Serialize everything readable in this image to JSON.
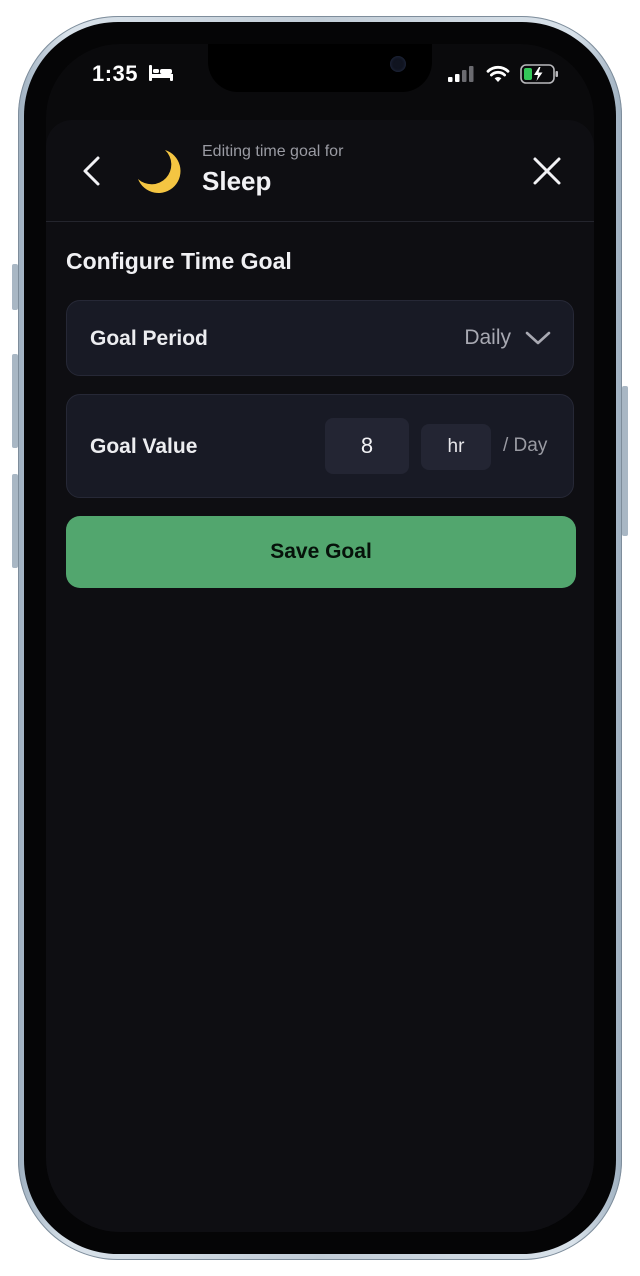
{
  "status_bar": {
    "time": "1:35",
    "sleep_focus_icon": "bed-icon",
    "signal_icon": "cellular-signal-icon",
    "wifi_icon": "wifi-icon",
    "battery_icon": "battery-charging-icon",
    "battery_color": "#34c759"
  },
  "header": {
    "back_icon": "chevron-left-icon",
    "activity_icon": "crescent-moon-icon",
    "subtitle": "Editing time goal for",
    "activity_name": "Sleep",
    "close_icon": "close-icon"
  },
  "section": {
    "title": "Configure Time Goal"
  },
  "goal_period": {
    "label": "Goal Period",
    "selected": "Daily",
    "dropdown_icon": "chevron-down-icon"
  },
  "goal_value": {
    "label": "Goal Value",
    "value": "8",
    "unit": "hr",
    "per_label": "/ Day"
  },
  "actions": {
    "save_label": "Save Goal"
  },
  "colors": {
    "accent": "#52a66e",
    "moon": "#f4c542",
    "background": "#0e0e12",
    "card": "#181a25"
  }
}
